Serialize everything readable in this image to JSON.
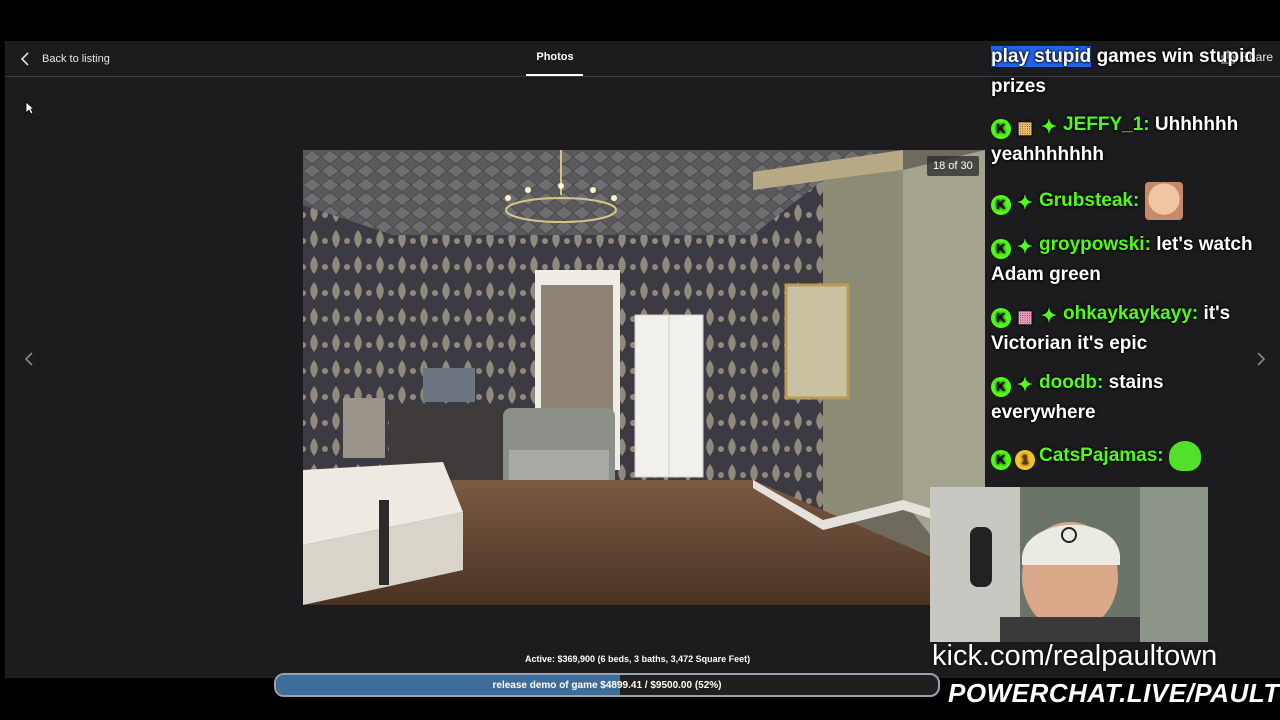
{
  "header": {
    "back_label": "Back to listing",
    "tab_label": "Photos",
    "share_label": "Share"
  },
  "photo": {
    "counter": "18 of 30"
  },
  "listing": {
    "summary": "Active: $369,900 (6 beds, 3 baths, 3,472 Square Feet)"
  },
  "goal": {
    "text": "release demo of game $4899.41 / $9500.00 (52%)",
    "progress": 0.52
  },
  "chat": {
    "messages": [
      {
        "user": "",
        "text": "play stupid games win stupid prizes"
      },
      {
        "user": "JEFFY_1:",
        "text": "Uhhhhhh yeahhhhhhh"
      },
      {
        "user": "Grubsteak:",
        "text": ""
      },
      {
        "user": "groypowski:",
        "text": "let's watch Adam green"
      },
      {
        "user": "ohkaykaykayy:",
        "text": "it's Victorian it's epic"
      },
      {
        "user": "doodb:",
        "text": "stains everywhere"
      },
      {
        "user": "CatsPajamas:",
        "text": ""
      }
    ],
    "badges": {
      "kick": "K",
      "sub": "1"
    },
    "highlight": "play stupid"
  },
  "stream": {
    "url": "kick.com/realpaultown",
    "banner": "POWERCHAT.LIVE/PAULTOWN"
  },
  "colors": {
    "username": "#53fc18",
    "goal_fill": "#3f6d99",
    "app_bg": "#1c1c1e"
  }
}
